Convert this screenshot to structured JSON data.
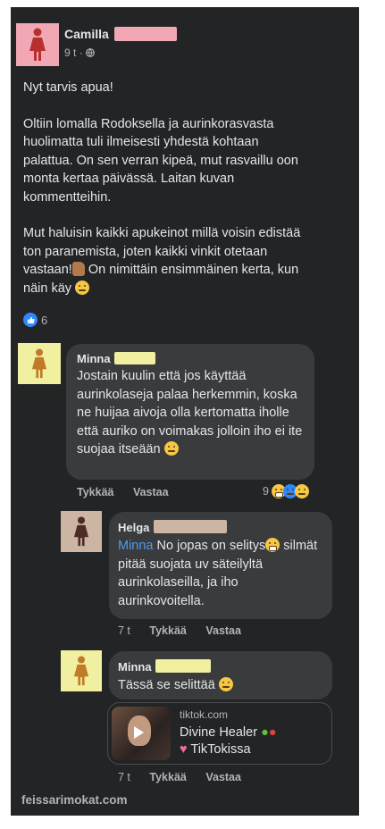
{
  "post": {
    "author": "Camilla",
    "time": "9 t",
    "audience_icon": "globe-icon",
    "paragraphs": [
      "Nyt tarvis apua!",
      "Oltiin lomalla Rodoksella ja aurinkorasvasta huolimatta tuli ilmeisesti yhdestä kohtaan palattua. On sen verran kipeä, mut rasvaillu oon  monta kertaa päivässä. Laitan kuvan kommentteihin.",
      "Mut haluisin kaikki apukeinot millä voisin edistää ton paranemista, joten kaikki vinkit otetaan vastaan!",
      " On nimittäin ensimmäinen kerta, kun näin käy"
    ],
    "reaction_count": "6"
  },
  "comments": [
    {
      "author": "Minna",
      "text": "Jostain kuulin että jos käyttää aurinkolaseja palaa herkemmin, koska ne huijaa aivoja olla kertomatta iholle että auriko on voimakas jolloin iho ei ite suojaa itseään",
      "like": "Tykkää",
      "reply": "Vastaa",
      "reaction_count": "9"
    },
    {
      "author": "Helga",
      "mention": "Minna",
      "text_a": " No jopas on selitys",
      "text_b": " silmät pitää suojata uv säteilyltä aurinkolaseilla, ja iho aurinkovoitella.",
      "time": "7 t",
      "like": "Tykkää",
      "reply": "Vastaa"
    },
    {
      "author": "Minna",
      "text": "Tässä se selittää",
      "time": "7 t",
      "like": "Tykkää",
      "reply": "Vastaa",
      "link": {
        "domain": "tiktok.com",
        "title_a": "Divine Healer",
        "title_b": "TikTokissa"
      }
    }
  ],
  "watermark": "feissarimokat.com",
  "colors": {
    "background": "#232425",
    "bubble": "#3a3b3c",
    "mention": "#4e9af1",
    "redaction_pink": "#f2a7b4",
    "redaction_yellow": "#f0f0a0",
    "redaction_tan": "#cdb5a3"
  }
}
